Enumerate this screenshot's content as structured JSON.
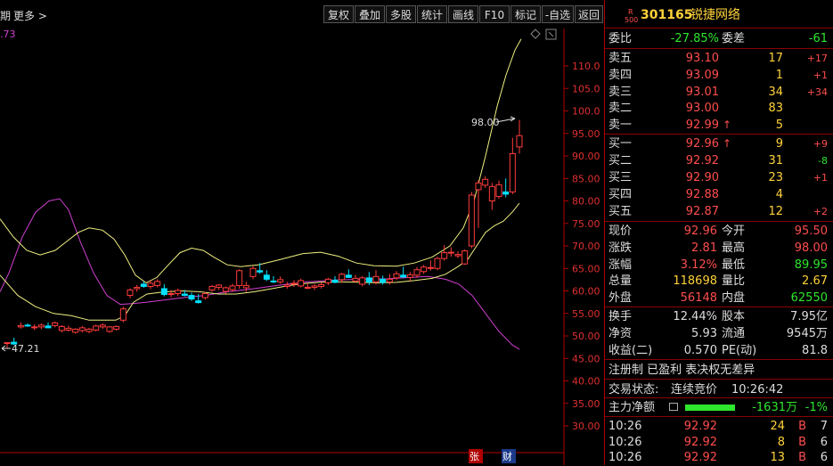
{
  "toolbar": {
    "period_partial": "期",
    "more": "更多 >",
    "buttons": [
      "复权",
      "叠加",
      "多股",
      "统计",
      "画线",
      "F10",
      "标记",
      "-自选",
      "返回"
    ]
  },
  "indicator_value": ".73",
  "chart_data": {
    "type": "candlestick",
    "y_ticks": [
      "110.0",
      "105.0",
      "100.0",
      "95.00",
      "90.00",
      "85.00",
      "80.00",
      "75.00",
      "70.00",
      "65.00",
      "60.00",
      "55.00",
      "50.00",
      "45.00",
      "40.00",
      "35.00",
      "30.00"
    ],
    "high_label": "98.00",
    "low_label": "47.21",
    "ylim": [
      26,
      117
    ],
    "candles": [
      [
        48.5,
        48.5,
        47.2,
        48.5
      ],
      [
        48.6,
        49.6,
        48.0,
        48.2
      ],
      [
        52.0,
        53.0,
        51.6,
        52.3
      ],
      [
        52.4,
        52.8,
        52.0,
        52.2
      ],
      [
        51.8,
        52.6,
        51.3,
        52.0
      ],
      [
        52.0,
        52.8,
        51.5,
        52.4
      ],
      [
        52.2,
        53.0,
        51.7,
        51.8
      ],
      [
        52.3,
        53.2,
        51.9,
        52.9
      ],
      [
        51.2,
        52.4,
        50.8,
        52.1
      ],
      [
        51.3,
        52.3,
        51.0,
        51.7
      ],
      [
        50.8,
        51.7,
        50.5,
        51.5
      ],
      [
        51.2,
        52.2,
        50.8,
        51.8
      ],
      [
        51.0,
        51.8,
        50.6,
        51.5
      ],
      [
        51.3,
        52.5,
        51.0,
        52.2
      ],
      [
        52.0,
        52.8,
        51.6,
        52.4
      ],
      [
        51.0,
        52.2,
        50.7,
        52.0
      ],
      [
        51.5,
        52.3,
        51.2,
        52.1
      ],
      [
        53.5,
        56.5,
        53.0,
        56.0
      ],
      [
        59.0,
        60.6,
        58.4,
        60.2
      ],
      [
        60.5,
        61.3,
        59.8,
        60.8
      ],
      [
        61.5,
        62.2,
        60.7,
        61.0
      ],
      [
        61.0,
        62.3,
        60.4,
        61.7
      ],
      [
        61.2,
        62.6,
        60.8,
        62.1
      ],
      [
        60.5,
        61.5,
        58.8,
        59.2
      ],
      [
        59.2,
        60.2,
        58.6,
        59.4
      ],
      [
        59.4,
        60.5,
        58.8,
        60.1
      ],
      [
        59.3,
        60.2,
        58.8,
        59.0
      ],
      [
        59.0,
        59.6,
        57.8,
        58.2
      ],
      [
        57.8,
        59.3,
        57.2,
        57.4
      ],
      [
        58.5,
        59.8,
        58.1,
        59.4
      ],
      [
        60.2,
        61.3,
        59.8,
        61.0
      ],
      [
        60.8,
        61.5,
        60.2,
        61.3
      ],
      [
        59.9,
        61.0,
        59.4,
        60.7
      ],
      [
        60.3,
        61.6,
        59.8,
        61.1
      ],
      [
        61.2,
        64.8,
        60.5,
        64.5
      ],
      [
        60.7,
        62.0,
        59.8,
        61.2
      ],
      [
        63.2,
        65.5,
        62.6,
        65.0
      ],
      [
        64.5,
        66.2,
        63.8,
        64.2
      ],
      [
        63.5,
        64.6,
        62.2,
        62.6
      ],
      [
        62.2,
        63.3,
        61.7,
        62.0
      ],
      [
        62.0,
        63.2,
        61.6,
        62.5
      ],
      [
        61.0,
        62.0,
        60.5,
        61.3
      ],
      [
        61.5,
        62.4,
        60.9,
        61.7
      ],
      [
        61.1,
        62.7,
        60.8,
        62.3
      ],
      [
        60.8,
        61.7,
        60.4,
        60.8
      ],
      [
        60.8,
        61.5,
        60.2,
        61.1
      ],
      [
        61.0,
        61.9,
        60.5,
        61.4
      ],
      [
        61.8,
        62.9,
        61.3,
        62.6
      ],
      [
        62.4,
        63.3,
        61.7,
        61.9
      ],
      [
        62.5,
        64.0,
        61.8,
        63.7
      ],
      [
        63.5,
        64.8,
        62.9,
        63.0
      ],
      [
        62.2,
        63.6,
        61.9,
        62.8
      ],
      [
        61.5,
        63.3,
        61.0,
        62.9
      ],
      [
        62.9,
        64.2,
        61.3,
        62.0
      ],
      [
        62.0,
        64.6,
        61.4,
        63.2
      ],
      [
        62.6,
        63.4,
        61.4,
        61.9
      ],
      [
        62.0,
        63.8,
        61.4,
        62.6
      ],
      [
        62.9,
        64.4,
        62.4,
        63.8
      ],
      [
        63.5,
        65.4,
        62.9,
        63.1
      ],
      [
        63.0,
        64.2,
        62.2,
        63.6
      ],
      [
        63.5,
        65.3,
        62.9,
        64.7
      ],
      [
        64.3,
        65.8,
        63.8,
        65.3
      ],
      [
        65.0,
        66.8,
        64.5,
        65.2
      ],
      [
        65.0,
        67.6,
        64.6,
        67.2
      ],
      [
        67.2,
        70.2,
        66.7,
        68.5
      ],
      [
        68.5,
        69.7,
        67.6,
        68.6
      ],
      [
        67.8,
        68.8,
        67.3,
        68.1
      ],
      [
        66.0,
        69.2,
        65.8,
        68.9
      ],
      [
        70.0,
        82.0,
        69.5,
        81.3
      ],
      [
        82.5,
        84.6,
        74.0,
        84.0
      ],
      [
        83.5,
        85.5,
        82.9,
        84.8
      ],
      [
        80.0,
        84.0,
        78.0,
        83.2
      ],
      [
        81.0,
        84.5,
        80.5,
        83.6
      ],
      [
        82.0,
        85.0,
        80.8,
        81.5
      ],
      [
        82.0,
        94.0,
        81.5,
        90.5
      ],
      [
        92.0,
        98.0,
        90.5,
        94.5
      ]
    ],
    "upper_band": [
      [
        0,
        76
      ],
      [
        15,
        72
      ],
      [
        30,
        69
      ],
      [
        45,
        68
      ],
      [
        62,
        69
      ],
      [
        75,
        71
      ],
      [
        88,
        73
      ],
      [
        100,
        74
      ],
      [
        115,
        73.5
      ],
      [
        128,
        71.5
      ],
      [
        140,
        68
      ],
      [
        152,
        63.5
      ],
      [
        164,
        61.8
      ],
      [
        176,
        63
      ],
      [
        190,
        66
      ],
      [
        202,
        68.5
      ],
      [
        215,
        69.5
      ],
      [
        228,
        69
      ],
      [
        240,
        67.5
      ],
      [
        255,
        65.8
      ],
      [
        270,
        65.4
      ],
      [
        290,
        65.8
      ],
      [
        315,
        67
      ],
      [
        340,
        68.3
      ],
      [
        360,
        68.6
      ],
      [
        380,
        67.7
      ],
      [
        400,
        66.2
      ],
      [
        420,
        65.6
      ],
      [
        445,
        65.5
      ],
      [
        465,
        66.2
      ],
      [
        485,
        67.5
      ],
      [
        505,
        70
      ],
      [
        520,
        74
      ],
      [
        532,
        80
      ],
      [
        545,
        90
      ],
      [
        558,
        101
      ],
      [
        568,
        108
      ],
      [
        578,
        113.5
      ],
      [
        585,
        116
      ]
    ],
    "lower_band": [
      [
        0,
        63.5
      ],
      [
        20,
        59
      ],
      [
        40,
        56.5
      ],
      [
        60,
        55
      ],
      [
        80,
        54.5
      ],
      [
        100,
        53.5
      ],
      [
        115,
        53.5
      ],
      [
        130,
        53.5
      ],
      [
        140,
        54.5
      ],
      [
        150,
        57.5
      ],
      [
        165,
        59.3
      ],
      [
        185,
        59.8
      ],
      [
        205,
        60
      ],
      [
        225,
        59.8
      ],
      [
        245,
        59.3
      ],
      [
        265,
        59.3
      ],
      [
        285,
        59.8
      ],
      [
        305,
        60.5
      ],
      [
        325,
        61.2
      ],
      [
        345,
        61.7
      ],
      [
        365,
        62
      ],
      [
        385,
        62
      ],
      [
        405,
        61.9
      ],
      [
        425,
        61.8
      ],
      [
        445,
        61.9
      ],
      [
        465,
        62.3
      ],
      [
        485,
        62.8
      ],
      [
        500,
        63.7
      ],
      [
        515,
        65.5
      ],
      [
        525,
        67
      ],
      [
        535,
        70
      ],
      [
        545,
        73
      ],
      [
        555,
        74.5
      ],
      [
        565,
        75.5
      ],
      [
        575,
        77.5
      ],
      [
        583,
        79.5
      ]
    ],
    "ma_line": [
      [
        0,
        59.8
      ],
      [
        10,
        64
      ],
      [
        25,
        72
      ],
      [
        40,
        77.5
      ],
      [
        55,
        80
      ],
      [
        67,
        80.5
      ],
      [
        77,
        78
      ],
      [
        90,
        71
      ],
      [
        105,
        64
      ],
      [
        120,
        59
      ],
      [
        135,
        57
      ],
      [
        150,
        57.2
      ],
      [
        165,
        57.5
      ],
      [
        185,
        58
      ],
      [
        205,
        58.5
      ],
      [
        230,
        59
      ],
      [
        255,
        59.8
      ],
      [
        285,
        60.5
      ],
      [
        315,
        61.3
      ],
      [
        345,
        62
      ],
      [
        375,
        62.4
      ],
      [
        405,
        62.6
      ],
      [
        435,
        62.7
      ],
      [
        460,
        63
      ],
      [
        480,
        63.2
      ],
      [
        500,
        62.6
      ],
      [
        515,
        61.5
      ],
      [
        530,
        59
      ],
      [
        545,
        55
      ],
      [
        560,
        51
      ],
      [
        575,
        48
      ],
      [
        583,
        47
      ]
    ]
  },
  "chart_footer": {
    "tag_zhang": "张",
    "tag_cai": "财"
  },
  "quote": {
    "code_prefix_top": "R",
    "code_prefix_bottom": "500",
    "code": "301165",
    "name": "锐捷网络",
    "wei_bi_label": "委比",
    "wei_bi_value": "-27.85%",
    "wei_cha_label": "委差",
    "wei_cha_value": "-61",
    "sell": [
      {
        "label": "卖五",
        "price": "93.10",
        "vol": "17",
        "chg": "+17"
      },
      {
        "label": "卖四",
        "price": "93.09",
        "vol": "1",
        "chg": "+1"
      },
      {
        "label": "卖三",
        "price": "93.01",
        "vol": "34",
        "chg": "+34"
      },
      {
        "label": "卖二",
        "price": "93.00",
        "vol": "83",
        "chg": ""
      },
      {
        "label": "卖一",
        "price": "92.99",
        "vol": "5",
        "chg": "",
        "arrow": "↑"
      }
    ],
    "buy": [
      {
        "label": "买一",
        "price": "92.96",
        "vol": "9",
        "chg": "+9",
        "arrow": "↑"
      },
      {
        "label": "买二",
        "price": "92.92",
        "vol": "31",
        "chg": "-8"
      },
      {
        "label": "买三",
        "price": "92.90",
        "vol": "23",
        "chg": "+1"
      },
      {
        "label": "买四",
        "price": "92.88",
        "vol": "4",
        "chg": ""
      },
      {
        "label": "买五",
        "price": "92.87",
        "vol": "12",
        "chg": "+2"
      }
    ],
    "stats": [
      {
        "l1": "现价",
        "v1": "92.96",
        "l2": "今开",
        "v2": "95.50"
      },
      {
        "l1": "涨跌",
        "v1": "2.81",
        "l2": "最高",
        "v2": "98.00"
      },
      {
        "l1": "涨幅",
        "v1": "3.12%",
        "l2": "最低",
        "v2": "89.95"
      },
      {
        "l1": "总量",
        "v1": "118698",
        "l2": "量比",
        "v2": "2.67"
      },
      {
        "l1": "外盘",
        "v1": "56148",
        "l2": "内盘",
        "v2": "62550"
      }
    ],
    "stats2": [
      {
        "l1": "换手",
        "v1": "12.44%",
        "l2": "股本",
        "v2": "7.95亿"
      },
      {
        "l1": "净资",
        "v1": "5.93",
        "l2": "流通",
        "v2": "9545万"
      },
      {
        "l1": "收益(二)",
        "v1": "0.570",
        "l2": "PE(动)",
        "v2": "81.8"
      }
    ],
    "reg_line": "注册制 已盈利 表决权无差异",
    "trade_status_label": "交易状态:",
    "trade_status_value": "连续竞价",
    "trade_time": "10:26:42",
    "main_flow_label": "主力净额",
    "main_flow_value": "-1631万",
    "main_flow_pct": "-1%",
    "ticks": [
      {
        "time": "10:26",
        "price": "92.92",
        "vol": "24",
        "side": "B",
        "n": "7"
      },
      {
        "time": "10:26",
        "price": "92.92",
        "vol": "8",
        "side": "B",
        "n": "6"
      },
      {
        "time": "10:26",
        "price": "92.92",
        "vol": "13",
        "side": "B",
        "n": "6"
      }
    ]
  },
  "colors": {
    "up": "#ff3c3c",
    "down": "#00e0ff",
    "upper_band": "#f0f080",
    "lower_band": "#f0f080",
    "ma": "#d040d0",
    "axis": "#b00000",
    "price": "#ff4d4d",
    "vol": "#ffd23a",
    "green": "#2ee62e"
  }
}
